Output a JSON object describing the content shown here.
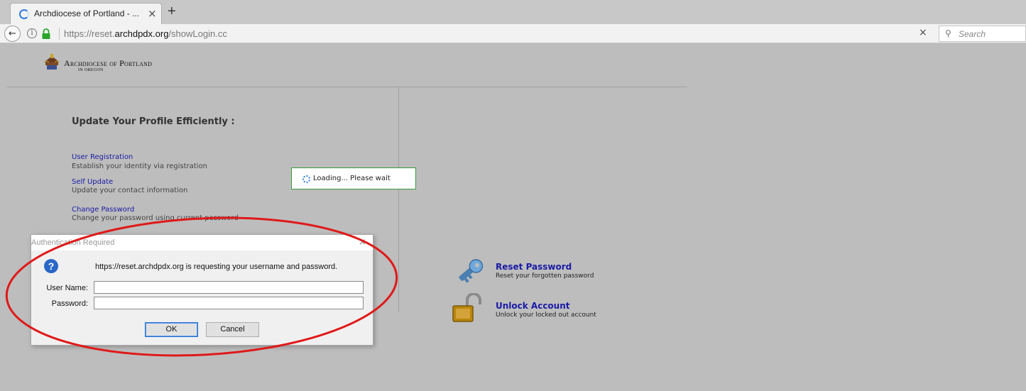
{
  "browser": {
    "tab_title": "Archdiocese of Portland - ...",
    "tab_close": "×",
    "new_tab": "+",
    "back": "←",
    "url_prefix": "https://reset.",
    "url_domain": "archdpdx.org",
    "url_path": "/showLogin.cc",
    "clear": "×",
    "search_placeholder": "Search"
  },
  "page": {
    "org_name": "Archdiocese of Portland",
    "org_sub": "IN OREGON",
    "heading": "Update Your Profile Efficiently :",
    "links": [
      {
        "label": "User Registration",
        "desc": "Establish your identity via registration"
      },
      {
        "label": "Self Update",
        "desc": "Update your contact information"
      },
      {
        "label": "Change Password",
        "desc": "Change your password using current password"
      }
    ],
    "loading_text": "Loading... Please wait",
    "right_links": [
      {
        "label": "Reset Password",
        "desc": "Reset your forgotten password"
      },
      {
        "label": "Unlock Account",
        "desc": "Unlock your locked out account"
      }
    ]
  },
  "dialog": {
    "title": "Authentication Required",
    "close": "×",
    "help": "?",
    "message": "https://reset.archdpdx.org is requesting your username and password.",
    "username_label": "User Name:",
    "password_label": "Password:",
    "username_value": "",
    "password_value": "",
    "ok_label": "OK",
    "cancel_label": "Cancel"
  },
  "colors": {
    "page_bg": "#bdbdbd",
    "link": "#1a1aa6",
    "annotation": "#e01818"
  }
}
